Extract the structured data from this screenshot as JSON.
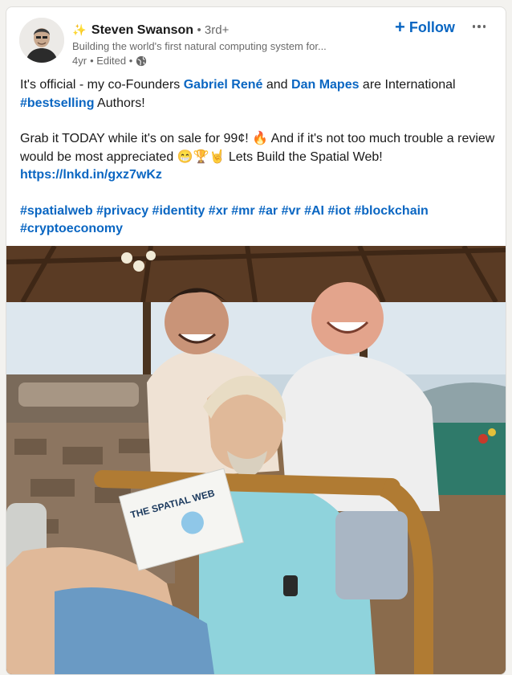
{
  "author": {
    "sparkle": "✨",
    "name": "Steven Swanson",
    "degree": "• 3rd+",
    "headline": "Building the world's first natural computing system for...",
    "time": "4yr",
    "edited": "• Edited •"
  },
  "actions": {
    "follow_label": "Follow",
    "follow_plus": "+"
  },
  "post": {
    "p1_a": "It's official - my co-Founders ",
    "mention1": "Gabriel René",
    "p1_b": " and ",
    "mention2": "Dan Mapes",
    "p1_c": " are International ",
    "tag_best": "#bestselling",
    "p1_d": " Authors!",
    "p2_a": "Grab it TODAY while it's on sale for 99¢! 🔥 And if it's not too much trouble a review would be most appreciated 😁🏆🤘 Lets Build the Spatial Web!",
    "link": "https://lnkd.in/gxz7wKz",
    "hashtags": [
      "#spatialweb",
      "#privacy",
      "#identity",
      "#xr",
      "#mr",
      "#ar",
      "#vr",
      "#AI",
      "#iot",
      "#blockchain",
      "#cryptoeconomy"
    ]
  },
  "image": {
    "book_title": "THE SPATIAL WEB"
  },
  "colors": {
    "link_blue": "#0a66c2",
    "sparkle": "#e8b100"
  }
}
